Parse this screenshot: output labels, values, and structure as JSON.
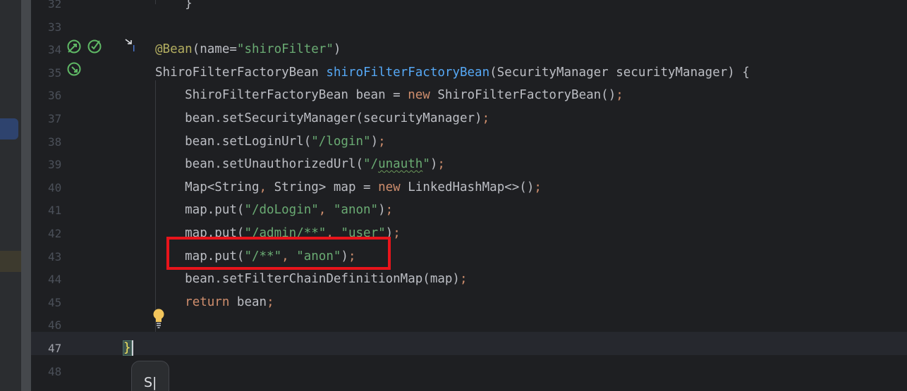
{
  "editor": {
    "lines": [
      {
        "n": "32",
        "segments": [
          {
            "t": "    }",
            "c": ""
          }
        ]
      },
      {
        "n": "33",
        "segments": []
      },
      {
        "n": "34",
        "segments": [
          {
            "t": "@Bean",
            "c": "ann"
          },
          {
            "t": "(name=",
            "c": ""
          },
          {
            "t": "\"shiroFilter\"",
            "c": "str"
          },
          {
            "t": ")",
            "c": ""
          }
        ]
      },
      {
        "n": "35",
        "segments": [
          {
            "t": "ShiroFilterFactoryBean ",
            "c": ""
          },
          {
            "t": "shiroFilterFactoryBean",
            "c": "fn"
          },
          {
            "t": "(SecurityManager securityManager) {",
            "c": ""
          }
        ]
      },
      {
        "n": "36",
        "segments": [
          {
            "t": "    ShiroFilterFactoryBean bean = ",
            "c": ""
          },
          {
            "t": "new ",
            "c": "kw"
          },
          {
            "t": "ShiroFilterFactoryBean()",
            "c": ""
          },
          {
            "t": ";",
            "c": "punc"
          }
        ]
      },
      {
        "n": "37",
        "segments": [
          {
            "t": "    bean.setSecurityManager(securityManager)",
            "c": ""
          },
          {
            "t": ";",
            "c": "punc"
          }
        ]
      },
      {
        "n": "38",
        "segments": [
          {
            "t": "    bean.setLoginUrl(",
            "c": ""
          },
          {
            "t": "\"/login\"",
            "c": "str"
          },
          {
            "t": ")",
            "c": ""
          },
          {
            "t": ";",
            "c": "punc"
          }
        ]
      },
      {
        "n": "39",
        "segments": [
          {
            "t": "    bean.setUnauthorizedUrl(",
            "c": ""
          },
          {
            "t": "\"/",
            "c": "str"
          },
          {
            "t": "unauth",
            "c": "str typo"
          },
          {
            "t": "\"",
            "c": "str"
          },
          {
            "t": ")",
            "c": ""
          },
          {
            "t": ";",
            "c": "punc"
          }
        ]
      },
      {
        "n": "40",
        "segments": [
          {
            "t": "    Map<String",
            "c": ""
          },
          {
            "t": ", ",
            "c": "punc"
          },
          {
            "t": "String> map = ",
            "c": ""
          },
          {
            "t": "new ",
            "c": "kw"
          },
          {
            "t": "LinkedHashMap<>()",
            "c": ""
          },
          {
            "t": ";",
            "c": "punc"
          }
        ]
      },
      {
        "n": "41",
        "segments": [
          {
            "t": "    map.put(",
            "c": ""
          },
          {
            "t": "\"/doLogin\"",
            "c": "str"
          },
          {
            "t": ", ",
            "c": "punc"
          },
          {
            "t": "\"anon\"",
            "c": "str"
          },
          {
            "t": ")",
            "c": ""
          },
          {
            "t": ";",
            "c": "punc"
          }
        ]
      },
      {
        "n": "42",
        "segments": [
          {
            "t": "    map.put(",
            "c": ""
          },
          {
            "t": "\"/admin/**\"",
            "c": "str"
          },
          {
            "t": ", ",
            "c": "punc"
          },
          {
            "t": "\"user\"",
            "c": "str"
          },
          {
            "t": ")",
            "c": ""
          },
          {
            "t": ";",
            "c": "punc"
          }
        ]
      },
      {
        "n": "43",
        "segments": [
          {
            "t": "    map.put(",
            "c": ""
          },
          {
            "t": "\"/**\"",
            "c": "str"
          },
          {
            "t": ", ",
            "c": "punc"
          },
          {
            "t": "\"anon\"",
            "c": "str"
          },
          {
            "t": ")",
            "c": ""
          },
          {
            "t": ";",
            "c": "punc"
          }
        ]
      },
      {
        "n": "44",
        "segments": [
          {
            "t": "    bean.setFilterChainDefinitionMap(map)",
            "c": ""
          },
          {
            "t": ";",
            "c": "punc"
          }
        ]
      },
      {
        "n": "45",
        "segments": [
          {
            "t": "    ",
            "c": ""
          },
          {
            "t": "return ",
            "c": "kw"
          },
          {
            "t": "bean",
            "c": ""
          },
          {
            "t": ";",
            "c": "punc"
          }
        ]
      },
      {
        "n": "46",
        "segments": []
      },
      {
        "n": "47",
        "segments": []
      },
      {
        "n": "48",
        "segments": []
      }
    ],
    "closing_brace": "}",
    "active_line": "47"
  },
  "popup": {
    "text": "S|"
  },
  "icons": {
    "line34": [
      "bean-navigate-icon",
      "bean-check-icon"
    ],
    "line35": "bean-navigate-icon",
    "fold": "implement-marker-icon",
    "hint": "lightbulb-icon"
  },
  "colors": {
    "highlight_box": "#e8141b"
  }
}
